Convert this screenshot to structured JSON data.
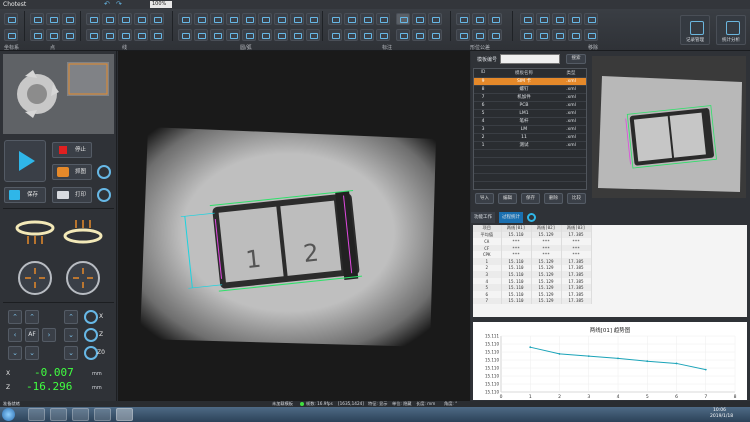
{
  "app": {
    "title": "Chotest"
  },
  "toolbar": {
    "zoom_value": "100%",
    "groups": [
      "坐标系",
      "点",
      "线",
      "圆/弧",
      "标注",
      "形位公差",
      "移除"
    ],
    "right_buttons": [
      "记录管理",
      "统计分析"
    ]
  },
  "controls": {
    "stop_label": "停止",
    "capture_label": "抓图",
    "save_label": "保存",
    "print_label": "打印"
  },
  "axes": {
    "x_label": "X",
    "y_label": "Y",
    "z_label": "Z",
    "z0_label": "Z0",
    "af_label": "AF",
    "x_value": "-0.007",
    "z_value": "-16.296",
    "unit": "mm"
  },
  "template": {
    "search_label": "模板编号",
    "search_button": "搜索",
    "columns": [
      "ID",
      "模板名称",
      "类型"
    ],
    "rows": [
      {
        "id": "9",
        "name": "SIM 卡",
        "type": ".xml",
        "selected": true
      },
      {
        "id": "8",
        "name": "螺钉",
        "type": ".xml"
      },
      {
        "id": "7",
        "name": "机加件",
        "type": ".xml"
      },
      {
        "id": "6",
        "name": "PCB",
        "type": ".xml"
      },
      {
        "id": "5",
        "name": "LM1",
        "type": ".xml"
      },
      {
        "id": "4",
        "name": "笔杆",
        "type": ".xml"
      },
      {
        "id": "3",
        "name": "LM",
        "type": ".xml"
      },
      {
        "id": "2",
        "name": "11",
        "type": ".xml"
      },
      {
        "id": "1",
        "name": "测试",
        "type": ".xml"
      }
    ],
    "buttons": [
      "导入",
      "编辑",
      "保存",
      "删除",
      "比较"
    ]
  },
  "tabs": [
    "功能工作",
    "过程统计"
  ],
  "data_table": {
    "columns": [
      "项目",
      "两线[01]",
      "两线[02]",
      "两线[03]"
    ],
    "rows": [
      [
        "平均值",
        "15.110",
        "15.129",
        "17.385"
      ],
      [
        "CA",
        "***",
        "***",
        "***"
      ],
      [
        "CF",
        "***",
        "***",
        "***"
      ],
      [
        "CPK",
        "***",
        "***",
        "***"
      ],
      [
        "1",
        "15.110",
        "15.129",
        "17.385"
      ],
      [
        "2",
        "15.110",
        "15.129",
        "17.385"
      ],
      [
        "3",
        "15.110",
        "15.129",
        "17.385"
      ],
      [
        "4",
        "15.110",
        "15.129",
        "17.385"
      ],
      [
        "5",
        "15.110",
        "15.129",
        "17.385"
      ],
      [
        "6",
        "15.110",
        "15.129",
        "17.385"
      ],
      [
        "7",
        "15.110",
        "15.129",
        "17.385"
      ]
    ]
  },
  "trend": {
    "title": "两线[01] 趋势图",
    "y_ticks": [
      "15.111",
      "15.110",
      "15.110",
      "15.110",
      "15.110",
      "15.110",
      "15.110",
      "15.110"
    ],
    "x_ticks": [
      "0",
      "1",
      "2",
      "3",
      "4",
      "5",
      "6",
      "7",
      "8"
    ],
    "points": [
      {
        "x": 1,
        "y": 0.8
      },
      {
        "x": 2,
        "y": 0.68
      },
      {
        "x": 3,
        "y": 0.64
      },
      {
        "x": 4,
        "y": 0.6
      },
      {
        "x": 5,
        "y": 0.55
      },
      {
        "x": 6,
        "y": 0.51
      },
      {
        "x": 7,
        "y": 0.4
      }
    ],
    "line_color": "#1aa3b8"
  },
  "status": {
    "left": "准备就绪",
    "middle": "未加载模板",
    "fps": "帧数: 16.9fps",
    "pos": "[1635,1424]",
    "feature": "特征: 显示",
    "unit": "单位: 隐藏",
    "length": "长度: mm",
    "angle": "角度: °"
  },
  "taskbar": {
    "time": "10:06",
    "date": "2019/1/18"
  },
  "colors": {
    "accent": "#67b8e6",
    "selected_row": "#e5892a",
    "coord_green": "#40ff40",
    "measure_cyan": "#1bd3e0",
    "measure_green": "#2fe06a"
  }
}
